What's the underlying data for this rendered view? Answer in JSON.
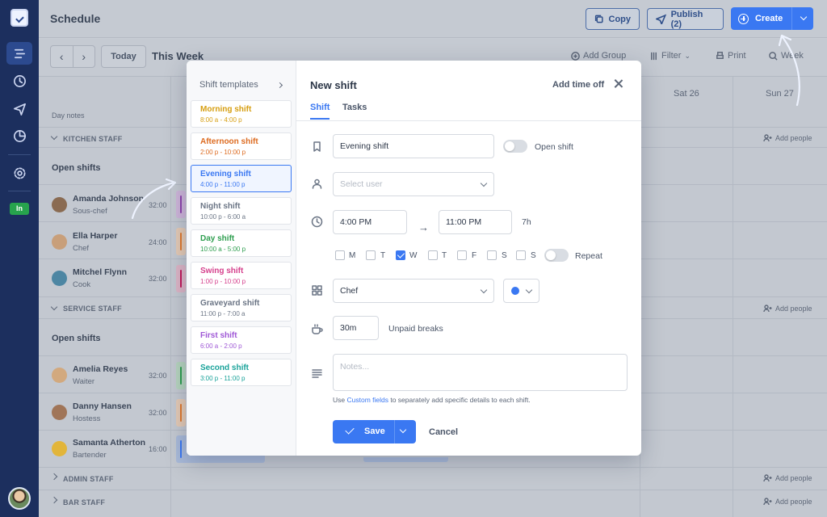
{
  "header": {
    "title": "Schedule",
    "copy_label": "Copy",
    "publish_label": "Publish (2)",
    "create_label": "Create"
  },
  "toolbar": {
    "today_label": "Today",
    "range_label": "This Week",
    "add_group_label": "Add Group",
    "filter_label": "Filter",
    "print_label": "Print",
    "view_label": "Week"
  },
  "sidebar": {
    "clock_status": "In"
  },
  "grid": {
    "day_headers": [
      "Sat 26",
      "Sun 27"
    ],
    "day_notes_label": "Day notes",
    "add_people_label": "Add people",
    "open_shifts_label": "Open shifts",
    "sections": [
      {
        "name": "KITCHEN STAFF"
      },
      {
        "name": "SERVICE STAFF"
      },
      {
        "name": "ADMIN STAFF"
      },
      {
        "name": "BAR STAFF"
      }
    ],
    "people": [
      {
        "name": "Amanda Johnson",
        "role": "Sous-chef",
        "hours": "32:00",
        "color": "#8e44ad"
      },
      {
        "name": "Ella Harper",
        "role": "Chef",
        "hours": "24:00",
        "color": "#e07a2f"
      },
      {
        "name": "Mitchel Flynn",
        "role": "Cook",
        "hours": "32:00",
        "color": "#c2185b"
      },
      {
        "name": "Amelia Reyes",
        "role": "Waiter",
        "hours": "32:00",
        "color": "#2e9e4f"
      },
      {
        "name": "Danny Hansen",
        "role": "Hostess",
        "hours": "32:00",
        "color": "#e07a2f"
      },
      {
        "name": "Samanta Atherton",
        "role": "Bartender",
        "hours": "16:00",
        "color": "#3a78f2"
      }
    ]
  },
  "modal": {
    "templates_heading": "Shift templates",
    "templates": [
      {
        "name": "Morning shift",
        "time": "8:00 a - 4:00 p",
        "color": "#d69e10"
      },
      {
        "name": "Afternoon shift",
        "time": "2:00 p - 10:00 p",
        "color": "#dd6b20"
      },
      {
        "name": "Evening shift",
        "time": "4:00 p - 11:00 p",
        "color": "#3a78f2"
      },
      {
        "name": "Night shift",
        "time": "10:00 p - 6:00 a",
        "color": "#6b7585"
      },
      {
        "name": "Day shift",
        "time": "10:00 a - 5:00 p",
        "color": "#2e9e4f"
      },
      {
        "name": "Swing shift",
        "time": "1:00 p - 10:00 p",
        "color": "#d53f8c"
      },
      {
        "name": "Graveyard shift",
        "time": "11:00 p - 7:00 a",
        "color": "#6b7585"
      },
      {
        "name": "First shift",
        "time": "6:00 a - 2:00 p",
        "color": "#9f58d6"
      },
      {
        "name": "Second shift",
        "time": "3:00 p - 11:00 p",
        "color": "#1aa39a"
      }
    ],
    "title": "New shift",
    "add_time_off_label": "Add time off",
    "tabs": [
      "Shift",
      "Tasks"
    ],
    "shift_name_value": "Evening shift",
    "open_shift_label": "Open shift",
    "user_placeholder": "Select user",
    "start_time": "4:00 PM",
    "end_time": "11:00 PM",
    "duration": "7h",
    "days": [
      {
        "label": "M",
        "checked": false
      },
      {
        "label": "T",
        "checked": false
      },
      {
        "label": "W",
        "checked": true
      },
      {
        "label": "T",
        "checked": false
      },
      {
        "label": "F",
        "checked": false
      },
      {
        "label": "S",
        "checked": false
      },
      {
        "label": "S",
        "checked": false
      }
    ],
    "repeat_label": "Repeat",
    "position_value": "Chef",
    "shift_color": "#3a78f2",
    "break_value": "30m",
    "break_label": "Unpaid breaks",
    "notes_placeholder": "Notes...",
    "hint_prefix": "Use ",
    "hint_link": "Custom fields",
    "hint_suffix": " to separately add specific details to each shift.",
    "save_label": "Save",
    "cancel_label": "Cancel"
  }
}
